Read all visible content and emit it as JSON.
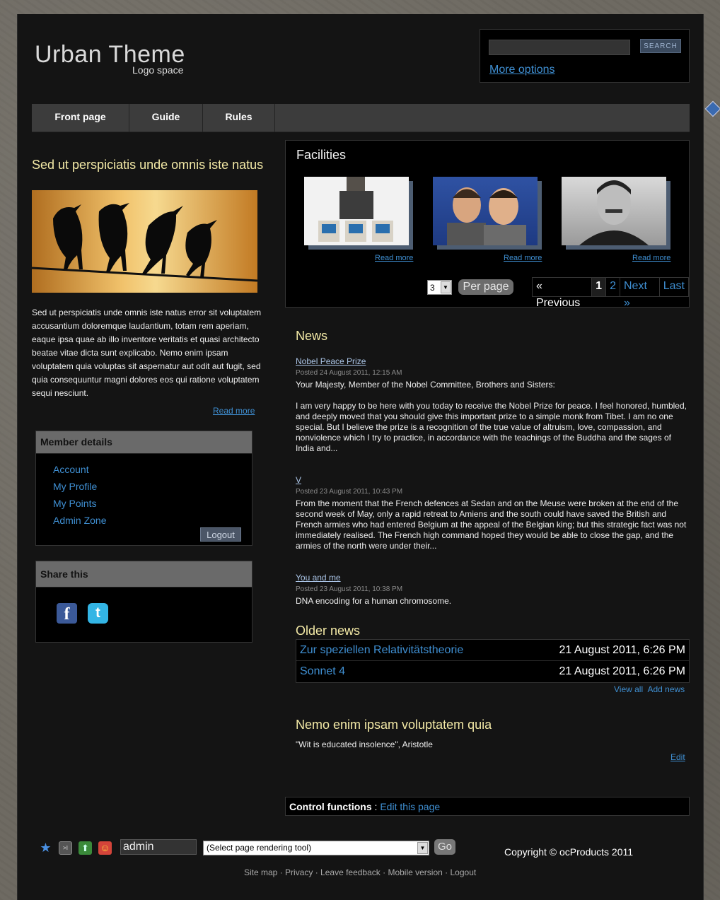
{
  "header": {
    "title": "Urban Theme",
    "subtitle": "Logo space",
    "search_button": "SEARCH",
    "more_options": "More options"
  },
  "nav": {
    "items": [
      "Front page",
      "Guide",
      "Rules"
    ]
  },
  "feature": {
    "title": "Sed ut perspiciatis unde omnis iste natus",
    "text": "Sed ut perspiciatis unde omnis iste natus error sit voluptatem accusantium doloremque laudantium, totam rem aperiam, eaque ipsa quae ab illo inventore veritatis et quasi architecto beatae vitae dicta sunt explicabo. Nemo enim ipsam voluptatem quia voluptas sit aspernatur aut odit aut fugit, sed quia consequuntur magni dolores eos qui ratione voluptatem sequi nesciunt.",
    "read_more": "Read more"
  },
  "member": {
    "title": "Member details",
    "links": [
      "Account",
      "My Profile",
      "My Points",
      "Admin Zone"
    ],
    "logout": "Logout"
  },
  "share": {
    "title": "Share this",
    "icons": [
      "facebook-icon",
      "twitter-icon"
    ]
  },
  "facilities": {
    "title": "Facilities",
    "read_more": "Read more",
    "per_page_value": "3",
    "per_page_label": "Per page",
    "pager": {
      "previous": "« Previous",
      "pages": [
        "1",
        "2"
      ],
      "next": "Next »",
      "last": "Last"
    }
  },
  "news": {
    "title": "News",
    "items": [
      {
        "title": "Nobel Peace Prize",
        "date": "Posted 24 August 2011, 12:15 AM",
        "lead": "Your Majesty, Member of the Nobel Committee, Brothers and Sisters:",
        "body": "I am very happy to be here with you today to receive the Nobel Prize for peace. I feel honored, humbled, and deeply moved that you should give this important prize to a simple monk from Tibet. I am no one special. But I believe the prize is a recognition of the true value of altruism, love, compassion, and nonviolence which I try to practice, in accordance with the teachings of the Buddha and the sages of India and..."
      },
      {
        "title": "V",
        "date": "Posted 23 August 2011, 10:43 PM",
        "body": "From the moment that the French defences at Sedan and on the Meuse were broken at the end of the second week of May, only a rapid retreat to Amiens and the south could have saved the British and French armies who had entered Belgium at the appeal of the Belgian king; but this strategic fact was not immediately realised. The French high command hoped they would be able to close the gap, and the armies of the north were under their..."
      },
      {
        "title": "You and me",
        "date": "Posted 23 August 2011, 10:38 PM",
        "body": "DNA encoding for a human chromosome."
      }
    ]
  },
  "older_news": {
    "title": "Older news",
    "rows": [
      {
        "title": "Zur speziellen Relativitätstheorie",
        "date": "21 August 2011, 6:26 PM"
      },
      {
        "title": "Sonnet 4",
        "date": "21 August 2011, 6:26 PM"
      }
    ],
    "view_all": "View all",
    "add_news": "Add news"
  },
  "quote": {
    "title": "Nemo enim ipsam voluptatem quia",
    "text": "\"Wit is educated insolence\", Aristotle",
    "edit": "Edit"
  },
  "control": {
    "label": "Control functions",
    "separator": " : ",
    "link": "Edit this page"
  },
  "footer": {
    "username": "admin",
    "tool_select": "(Select page rendering tool)",
    "go": "Go",
    "copyright": "Copyright © ocProducts 2011",
    "links": [
      "Site map",
      "Privacy",
      "Leave feedback",
      "Mobile version",
      "Logout"
    ],
    "link_separator": " · "
  },
  "colors": {
    "accent_link": "#3f8fd2",
    "heading": "#f3e9a6",
    "panel": "#000000",
    "page": "#141414"
  }
}
